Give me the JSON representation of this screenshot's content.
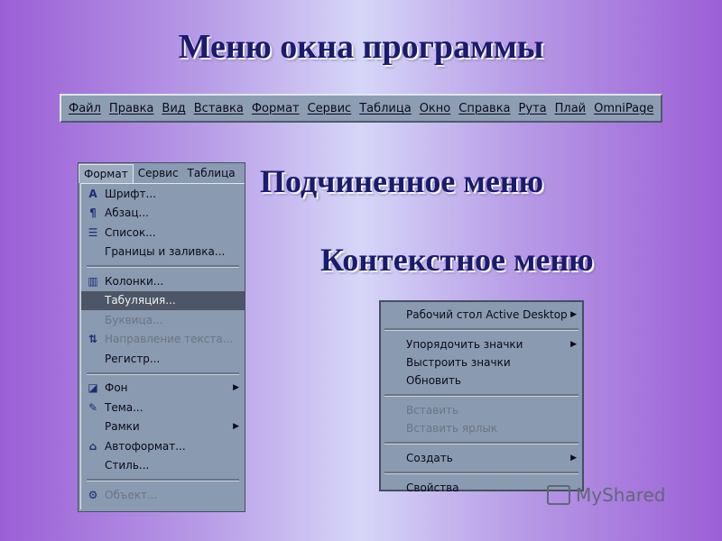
{
  "slide": {
    "title": "Меню окна программы",
    "submenu_caption": "Подчиненное меню",
    "context_caption": "Контекстное меню"
  },
  "menubar": {
    "items": [
      "Файл",
      "Правка",
      "Вид",
      "Вставка",
      "Формат",
      "Сервис",
      "Таблица",
      "Окно",
      "Справка",
      "Рута",
      "Плай",
      "OmniPage"
    ]
  },
  "dropdown": {
    "bar": [
      "Формат",
      "Сервис",
      "Таблица"
    ],
    "groups": [
      [
        {
          "icon": "font-icon",
          "glyph": "A",
          "label": "Шрифт..."
        },
        {
          "icon": "paragraph-icon",
          "glyph": "¶",
          "label": "Абзац..."
        },
        {
          "icon": "list-icon",
          "glyph": "☰",
          "label": "Список..."
        },
        {
          "icon": "",
          "glyph": "",
          "label": "Границы и заливка..."
        }
      ],
      [
        {
          "icon": "columns-icon",
          "glyph": "▥",
          "label": "Колонки..."
        },
        {
          "icon": "",
          "glyph": "",
          "label": "Табуляция...",
          "selected": true
        },
        {
          "icon": "",
          "glyph": "",
          "label": "Буквица...",
          "disabled": true
        },
        {
          "icon": "text-direction-icon",
          "glyph": "⇅",
          "label": "Направление текста...",
          "disabled": true
        },
        {
          "icon": "",
          "glyph": "",
          "label": "Регистр..."
        }
      ],
      [
        {
          "icon": "background-icon",
          "glyph": "◪",
          "label": "Фон",
          "submenu": true
        },
        {
          "icon": "theme-icon",
          "glyph": "✎",
          "label": "Тема..."
        },
        {
          "icon": "",
          "glyph": "",
          "label": "Рамки",
          "submenu": true
        },
        {
          "icon": "autoformat-icon",
          "glyph": "⌂",
          "label": "Автоформат..."
        },
        {
          "icon": "",
          "glyph": "",
          "label": "Стиль..."
        }
      ],
      [
        {
          "icon": "object-icon",
          "glyph": "⚙",
          "label": "Объект...",
          "disabled": true
        }
      ]
    ]
  },
  "context_menu": {
    "groups": [
      [
        {
          "label": "Рабочий стол Active Desktop",
          "submenu": true
        }
      ],
      [
        {
          "label": "Упорядочить значки",
          "submenu": true
        },
        {
          "label": "Выстроить значки"
        },
        {
          "label": "Обновить"
        }
      ],
      [
        {
          "label": "Вставить",
          "disabled": true
        },
        {
          "label": "Вставить ярлык",
          "disabled": true
        }
      ],
      [
        {
          "label": "Создать",
          "submenu": true
        }
      ],
      [
        {
          "label": "Свойства"
        }
      ]
    ]
  },
  "watermark": {
    "text": "MyShared"
  }
}
